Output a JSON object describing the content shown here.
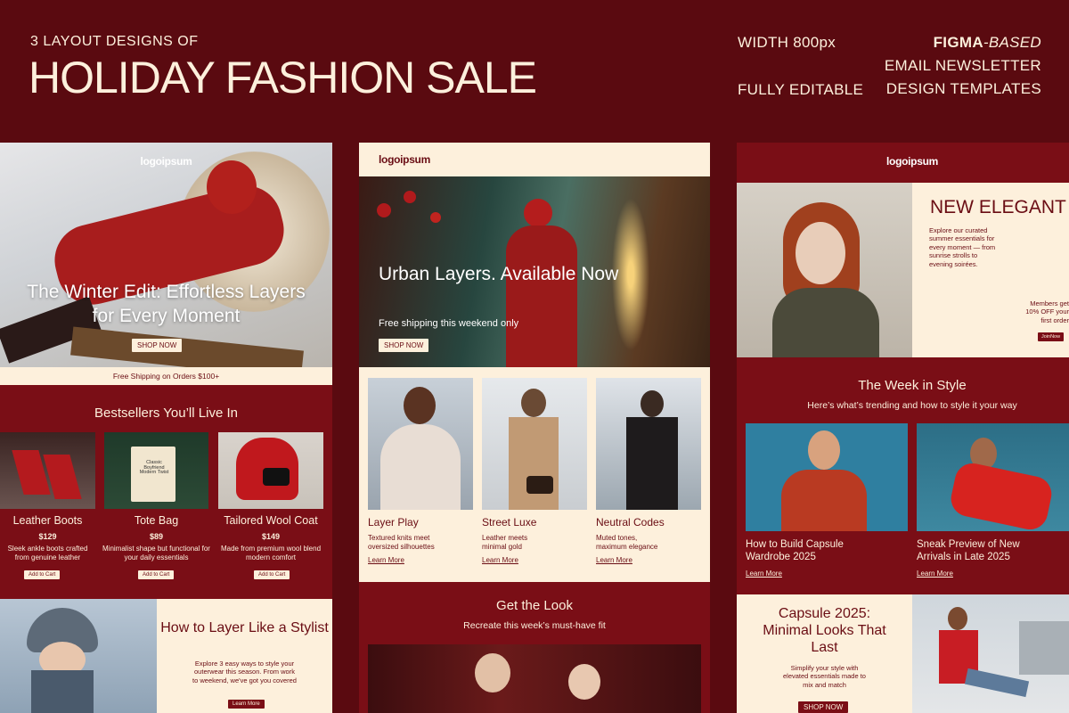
{
  "header": {
    "kicker": "3 LAYOUT DESIGNS OF",
    "title": "HOLIDAY FASHION SALE",
    "width": "WIDTH 800px",
    "editable": "FULLY EDITABLE",
    "figma_bold": "FIGMA",
    "figma_italic": "-BASED",
    "line2": "EMAIL NEWSLETTER",
    "line3": "DESIGN TEMPLATES"
  },
  "p1": {
    "logo": "logoipsum",
    "hero_title": "The Winter Edit: Effortless Layers for Every Moment",
    "hero_button": "SHOP NOW",
    "shipping": "Free Shipping on Orders $100+",
    "section_title": "Bestsellers You’ll Live In",
    "products": [
      {
        "name": "Leather Boots",
        "price": "$129",
        "desc": "Sleek ankle boots crafted from genuine leather",
        "button": "Add to Cart"
      },
      {
        "name": "Tote Bag",
        "price": "$89",
        "desc": "Minimalist shape but functional for your daily essentials",
        "button": "Add to Cart"
      },
      {
        "name": "Tailored Wool Coat",
        "price": "$149",
        "desc": "Made from premium wool blend modern comfort",
        "button": "Add to Cart"
      }
    ],
    "bag_text": "Classic Boyfriend Modern Twist",
    "layer_title": "How to Layer Like a Stylist",
    "layer_desc": "Explore 3 easy ways to style your outerwear this season. From work to weekend, we've got you covered",
    "layer_button": "Learn More"
  },
  "p2": {
    "logo": "logoipsum",
    "hero_title": "Urban Layers. Available Now",
    "hero_sub": "Free shipping this weekend only",
    "hero_button": "SHOP NOW",
    "cards": [
      {
        "title": "Layer Play",
        "desc": "Textured knits meet oversized silhouettes",
        "link": "Learn More"
      },
      {
        "title": "Street Luxe",
        "desc": "Leather meets minimal gold",
        "link": "Learn More"
      },
      {
        "title": "Neutral Codes",
        "desc": "Muted tones, maximum elegance",
        "link": "Learn More"
      }
    ],
    "look_title": "Get the Look",
    "look_sub": "Recreate this week’s must-have fit"
  },
  "p3": {
    "logo": "logoipsum",
    "hero_title": "NEW ELEGANT",
    "hero_desc": "Explore our curated summer essentials for every moment — from sunrise strolls to evening soirées.",
    "members": "Members get 10% OFF your first order",
    "join": "JoinNow",
    "week_title": "The Week in Style",
    "week_sub": "Here’s what’s trending and how to style it your way",
    "articles": [
      {
        "title": "How to Build Capsule Wardrobe 2025",
        "link": "Learn More"
      },
      {
        "title": "Sneak Preview of New Arrivals in Late 2025",
        "link": "Learn More"
      }
    ],
    "capsule_title": "Capsule 2025: Minimal Looks That Last",
    "capsule_desc": "Simplify your style with elevated essentials made to mix and match",
    "capsule_button": "SHOP NOW"
  },
  "colors": {
    "background": "#5a0a10",
    "brand_red": "#7a0e16",
    "cream": "#fdf0dc"
  }
}
